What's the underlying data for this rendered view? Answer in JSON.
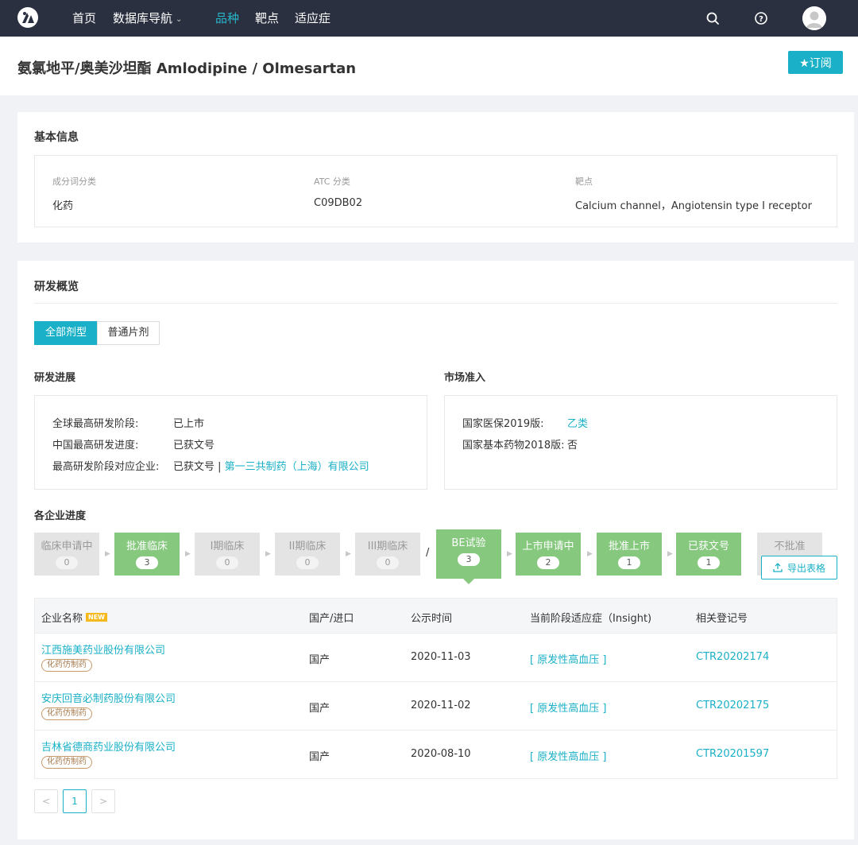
{
  "nav": {
    "items": [
      "首页",
      "数据库导航",
      "品种",
      "靶点",
      "适应症"
    ],
    "active": "品种"
  },
  "title": {
    "text": "氨氯地平/奥美沙坦酯 Amlodipine / Olmesartan",
    "subscribe": "★订阅"
  },
  "basic": {
    "heading": "基本信息",
    "fields": [
      {
        "label": "成分词分类",
        "value": "化药"
      },
      {
        "label": "ATC 分类",
        "value": "C09DB02"
      },
      {
        "label": "靶点",
        "value": "Calcium channel，Angiotensin type I receptor"
      }
    ]
  },
  "rd": {
    "heading": "研发概览",
    "tabs": [
      "全部剂型",
      "普通片剂"
    ],
    "progress": {
      "heading": "研发进展",
      "rows": [
        {
          "key": "全球最高研发阶段:",
          "value": "已上市"
        },
        {
          "key": "中国最高研发进度:",
          "value": "已获文号"
        },
        {
          "key": "最高研发阶段对应企业:",
          "value": "已获文号 | ",
          "link": "第一三共制药（上海）有限公司"
        }
      ]
    },
    "market": {
      "heading": "市场准入",
      "rows": [
        {
          "key": "国家医保2019版:",
          "value": "乙类"
        },
        {
          "key": "国家基本药物2018版:",
          "value": "否"
        }
      ]
    },
    "companies_heading": "各企业进度",
    "stages": [
      {
        "label": "临床申请中",
        "count": "0"
      },
      {
        "label": "批准临床",
        "count": "3"
      },
      {
        "label": "I期临床",
        "count": "0"
      },
      {
        "label": "II期临床",
        "count": "0"
      },
      {
        "label": "III期临床",
        "count": "0"
      },
      {
        "label": "BE试验",
        "count": "3"
      },
      {
        "label": "上市申请中",
        "count": "2"
      },
      {
        "label": "批准上市",
        "count": "1"
      },
      {
        "label": "已获文号",
        "count": "1"
      },
      {
        "label": "不批准",
        "count": ""
      }
    ],
    "slash": "/",
    "export": "导出表格",
    "table": {
      "headers": [
        "企业名称",
        "国产/进口",
        "公示时间",
        "当前阶段适应症（Insight)",
        "相关登记号"
      ],
      "new_badge": "NEW",
      "rows": [
        {
          "company": "江西施美药业股份有限公司",
          "tag": "化药仿制药",
          "origin": "国产",
          "date": "2020-11-03",
          "indication": "[ 原发性高血压 ]",
          "reg": "CTR20202174"
        },
        {
          "company": "安庆回音必制药股份有限公司",
          "tag": "化药仿制药",
          "origin": "国产",
          "date": "2020-11-02",
          "indication": "[ 原发性高血压 ]",
          "reg": "CTR20202175"
        },
        {
          "company": "吉林省德商药业股份有限公司",
          "tag": "化药仿制药",
          "origin": "国产",
          "date": "2020-08-10",
          "indication": "[ 原发性高血压 ]",
          "reg": "CTR20201597"
        }
      ]
    },
    "pagination": {
      "prev": "<",
      "current": "1",
      "next": ">"
    }
  },
  "colors": {
    "accent": "#1ab0c7",
    "stage_green": "#86c87e",
    "nav_bg": "#2b3040"
  },
  "icons": {
    "logo": "logo-icon",
    "search": "search-icon",
    "help": "help-icon",
    "avatar": "avatar-icon",
    "export": "upload-icon"
  }
}
